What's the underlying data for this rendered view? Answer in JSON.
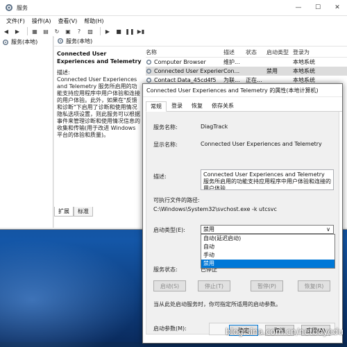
{
  "window": {
    "title": "服务"
  },
  "menu": [
    "文件(F)",
    "操作(A)",
    "查看(V)",
    "帮助(H)"
  ],
  "tree": {
    "root_label": "服务(本地)"
  },
  "content": {
    "header": "服务(本地)",
    "selected_name": "Connected User Experiences and Telemetry",
    "desc_label": "描述:",
    "desc_text": "Connected User Experiences and Telemetry 服务所启用的功能支持应用程序中用户体验和连接的用户体验。此外，如果在\"反馈和诊断\"下启用了诊断和使用情况隐私选项设置，则此服务可以根据事件来管理诊断和使用情况信息的收集和传输(用于改进 Windows 平台的体验和质量)。",
    "tabs": [
      "扩展",
      "标准"
    ],
    "columns": [
      "名称",
      "描述",
      "状态",
      "启动类型",
      "登录为"
    ],
    "rows": [
      {
        "name": "Computer Browser",
        "desc": "维护...",
        "status": "",
        "start": "",
        "logon": "本地系统"
      },
      {
        "name": "Connected User Experien...",
        "desc": "Con...",
        "status": "",
        "start": "禁用",
        "logon": "本地系统"
      },
      {
        "name": "Contact Data_45cd4f5",
        "desc": "为联...",
        "status": "正在...",
        "start": "",
        "logon": "本地系统"
      }
    ]
  },
  "dialog": {
    "title": "Connected User Experiences and Telemetry 的属性(本地计算机)",
    "tabs": [
      "常规",
      "登录",
      "恢复",
      "依存关系"
    ],
    "service_name_label": "服务名称:",
    "service_name": "DiagTrack",
    "display_name_label": "显示名称:",
    "display_name": "Connected User Experiences and Telemetry",
    "description_label": "描述:",
    "description": "Connected User Experiences and Telemetry 服务所启用的功能支持应用程序中用户体验和连接的用户体验",
    "exe_label": "可执行文件的路径:",
    "exe_path": "C:\\Windows\\System32\\svchost.exe -k utcsvc",
    "startup_label": "启动类型(E):",
    "startup_value": "禁用",
    "startup_options": [
      "自动(延迟启动)",
      "自动",
      "手动",
      "禁用"
    ],
    "status_label": "服务状态:",
    "status_value": "已停止",
    "buttons": {
      "start": "启动(S)",
      "stop": "停止(T)",
      "pause": "暂停(P)",
      "resume": "恢复(R)"
    },
    "hint": "当从此处启动服务时，你可指定所适用的启动参数。",
    "param_label": "启动参数(M):",
    "ok": "确定",
    "cancel": "取消",
    "apply": "应用(A)"
  },
  "watermark": "blog.sina.com.cn/netboyedu"
}
